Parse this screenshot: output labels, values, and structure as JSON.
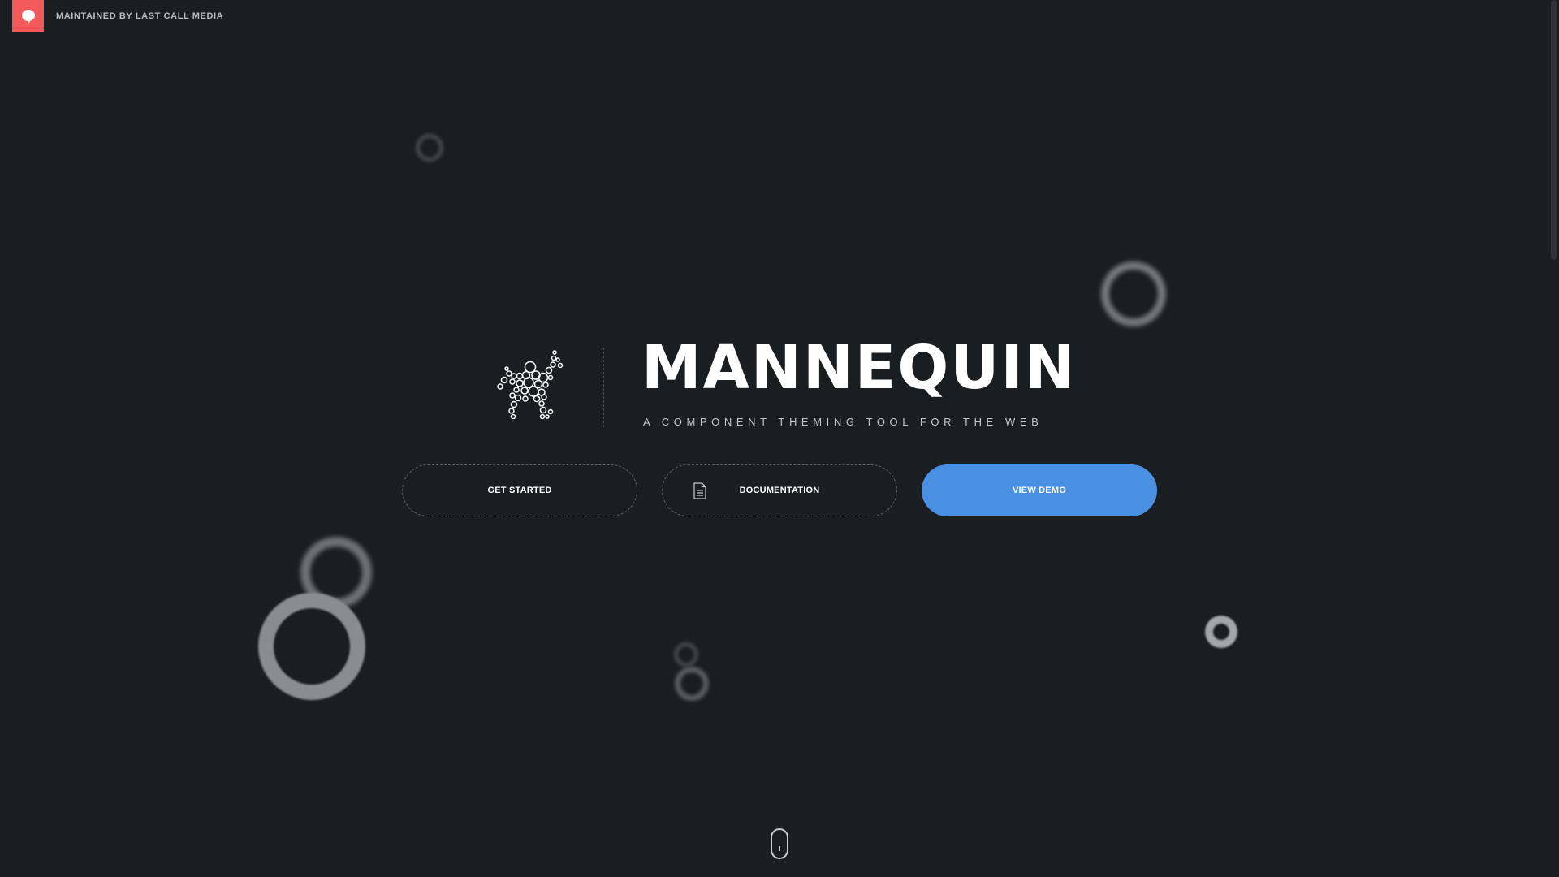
{
  "header": {
    "brand_icon": "speech-bubble-icon",
    "brand_color": "#f25a5a",
    "maintained_by": "MAINTAINED BY LAST CALL MEDIA"
  },
  "hero": {
    "logo_icon": "bubble-figure-logo",
    "title": "MANNEQUIN",
    "tagline": "A COMPONENT THEMING TOOL FOR THE WEB"
  },
  "actions": {
    "get_started": "GET STARTED",
    "documentation": "DOCUMENTATION",
    "documentation_icon": "document-icon",
    "view_demo": "VIEW DEMO",
    "primary_color": "#4a90e2"
  },
  "scroll_indicator": {
    "icon": "mouse-scroll-icon"
  },
  "colors": {
    "background": "#1b1e21"
  }
}
